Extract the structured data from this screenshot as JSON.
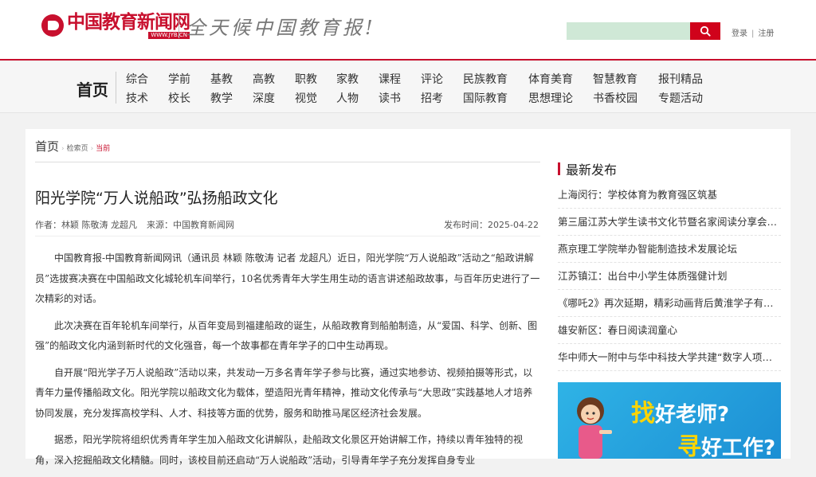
{
  "header": {
    "logo_cn": "中国教育新闻网",
    "logo_url": "WWW.JYB.CN",
    "slogan": "全天候中国教育报!",
    "search_placeholder": "",
    "login": "登录",
    "auth_sep": "|",
    "register": "注册"
  },
  "nav": {
    "home": "首页",
    "row1": [
      "综合",
      "学前",
      "基教",
      "高教",
      "职教",
      "家教",
      "课程",
      "评论",
      "民族教育",
      "体育美育",
      "智慧教育",
      "报刊精品"
    ],
    "row2": [
      "技术",
      "校长",
      "教学",
      "深度",
      "视觉",
      "人物",
      "读书",
      "招考",
      "国际教育",
      "思想理论",
      "书香校园",
      "专题活动"
    ]
  },
  "breadcrumb": {
    "home": "首页",
    "search": "检索页",
    "current": "当前"
  },
  "article": {
    "title": "阳光学院“万人说船政”弘扬船政文化",
    "author": "作者：林颖 陈敬涛 龙超凡",
    "source": "来源：中国教育新闻网",
    "date": "发布时间：2025-04-22",
    "paragraphs": [
      "中国教育报-中国教育新闻网讯（通讯员 林颖 陈敬涛 记者 龙超凡）近日，阳光学院“万人说船政”活动之“船政讲解员”选拔赛决赛在中国船政文化城轮机车间举行，10名优秀青年大学生用生动的语言讲述船政故事，与百年历史进行了一次精彩的对话。",
      "此次决赛在百年轮机车间举行，从百年变局到福建船政的诞生，从船政教育到船舶制造，从“爱国、科学、创新、图强”的船政文化内涵到新时代的文化强音，每一个故事都在青年学子的口中生动再现。",
      "自开展“阳光学子万人说船政”活动以来，共发动一万多名青年学子参与比赛，通过实地参访、视频拍摄等形式，以青年力量传播船政文化。阳光学院以船政文化为载体，塑造阳光青年精神，推动文化传承与“大思政”实践基地人才培养协同发展，充分发挥高校学科、人才、科技等方面的优势，服务和助推马尾区经济社会发展。",
      "据悉，阳光学院将组织优秀青年学生加入船政文化讲解队，赴船政文化景区开始讲解工作，持续以青年独特的视角，深入挖掘船政文化精髓。同时，该校目前还启动“万人说船政”活动，引导青年学子充分发挥自身专业"
    ]
  },
  "sidebar": {
    "title": "最新发布",
    "items": [
      "上海闵行：学校体育为教育强区筑基",
      "第三届江苏大学生读书文化节暨名家阅读分享会…",
      "燕京理工学院举办智能制造技术发展论坛",
      "江苏镇江：出台中小学生体质强健计划",
      "《哪吒2》再次延期，精彩动画背后黄淮学子有…",
      "雄安新区：春日阅读润童心",
      "华中师大一附中与华中科技大学共建“数字人项…"
    ],
    "banner": {
      "big1": "找",
      "text1": "好老师?",
      "big2": "寻",
      "text2": "好工作?"
    }
  },
  "colors": {
    "brand_red": "#c8102e",
    "search_bg": "#cfe8d6",
    "banner_blue": "#2fb3e6"
  }
}
